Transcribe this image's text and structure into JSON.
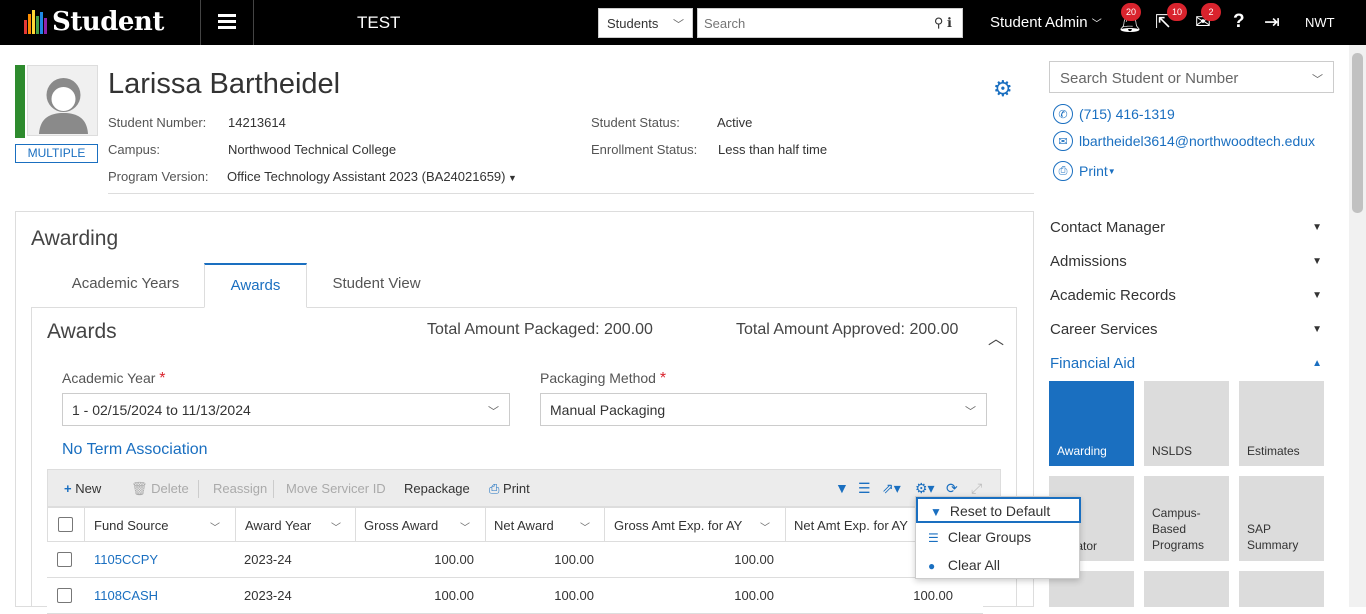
{
  "header": {
    "app_name": "Student",
    "environment": "TEST",
    "entity_select": "Students",
    "search_placeholder": "Search",
    "user": "Student Admin",
    "notifications_count": "20",
    "tasks_count": "10",
    "messages_count": "2",
    "help": "?",
    "campus_code": "NWT"
  },
  "student": {
    "name": "Larissa Bartheidel",
    "badge": "MULTIPLE",
    "number_label": "Student Number:",
    "number": "14213614",
    "campus_label": "Campus:",
    "campus": "Northwood Technical College",
    "program_label": "Program Version:",
    "program": "Office Technology Assistant 2023 (BA24021659)",
    "status_label": "Student Status:",
    "status": "Active",
    "enrollment_label": "Enrollment Status:",
    "enrollment": "Less than half time"
  },
  "right_panel": {
    "search_placeholder": "Search Student or Number",
    "phone": "(715) 416-1319",
    "email": "lbartheidel3614@northwoodtech.edux",
    "print": "Print",
    "menu": [
      "Contact Manager",
      "Admissions",
      "Academic Records",
      "Career Services",
      "Financial Aid"
    ],
    "tiles": [
      "Awarding",
      "NSLDS",
      "Estimates",
      "Calculator",
      "Campus-Based Programs",
      "SAP Summary"
    ],
    "tile_partial": "ulator",
    "tile_campus_l1": "Campus-",
    "tile_campus_l2": "Based",
    "tile_campus_l3": "Programs",
    "tile_sap_l1": "SAP",
    "tile_sap_l2": "Summary"
  },
  "main": {
    "title": "Awarding",
    "tabs": [
      "Academic Years",
      "Awards",
      "Student View"
    ],
    "active_tab": "Awards",
    "awards": {
      "title": "Awards",
      "total_packaged": "Total Amount Packaged: 200.00",
      "total_approved": "Total Amount Approved: 200.00",
      "academic_year_label": "Academic Year",
      "academic_year": "1 - 02/15/2024 to 11/13/2024",
      "packaging_label": "Packaging Method",
      "packaging": "Manual Packaging",
      "no_term": "No Term Association",
      "required_marker": "*"
    },
    "toolbar": {
      "new": "New",
      "delete": "Delete",
      "reassign": "Reassign",
      "move_servicer": "Move Servicer ID",
      "repackage": "Repackage",
      "print": "Print"
    },
    "columns": [
      "Fund Source",
      "Award Year",
      "Gross Award",
      "Net Award",
      "Gross Amt Exp. for AY",
      "Net Amt Exp. for AY"
    ],
    "rows": [
      {
        "fund": "1105CCPY",
        "year": "2023-24",
        "gross": "100.00",
        "net": "100.00",
        "gross_exp": "100.00",
        "net_exp": ""
      },
      {
        "fund": "1108CASH",
        "year": "2023-24",
        "gross": "100.00",
        "net": "100.00",
        "gross_exp": "100.00",
        "net_exp": "100.00"
      }
    ],
    "settings_menu": [
      "Reset to Default",
      "Clear Groups",
      "Clear All"
    ]
  },
  "colors": {
    "accent": "#1a6fc0",
    "status_green": "#2e8b2e",
    "badge_red": "#d9232d"
  }
}
